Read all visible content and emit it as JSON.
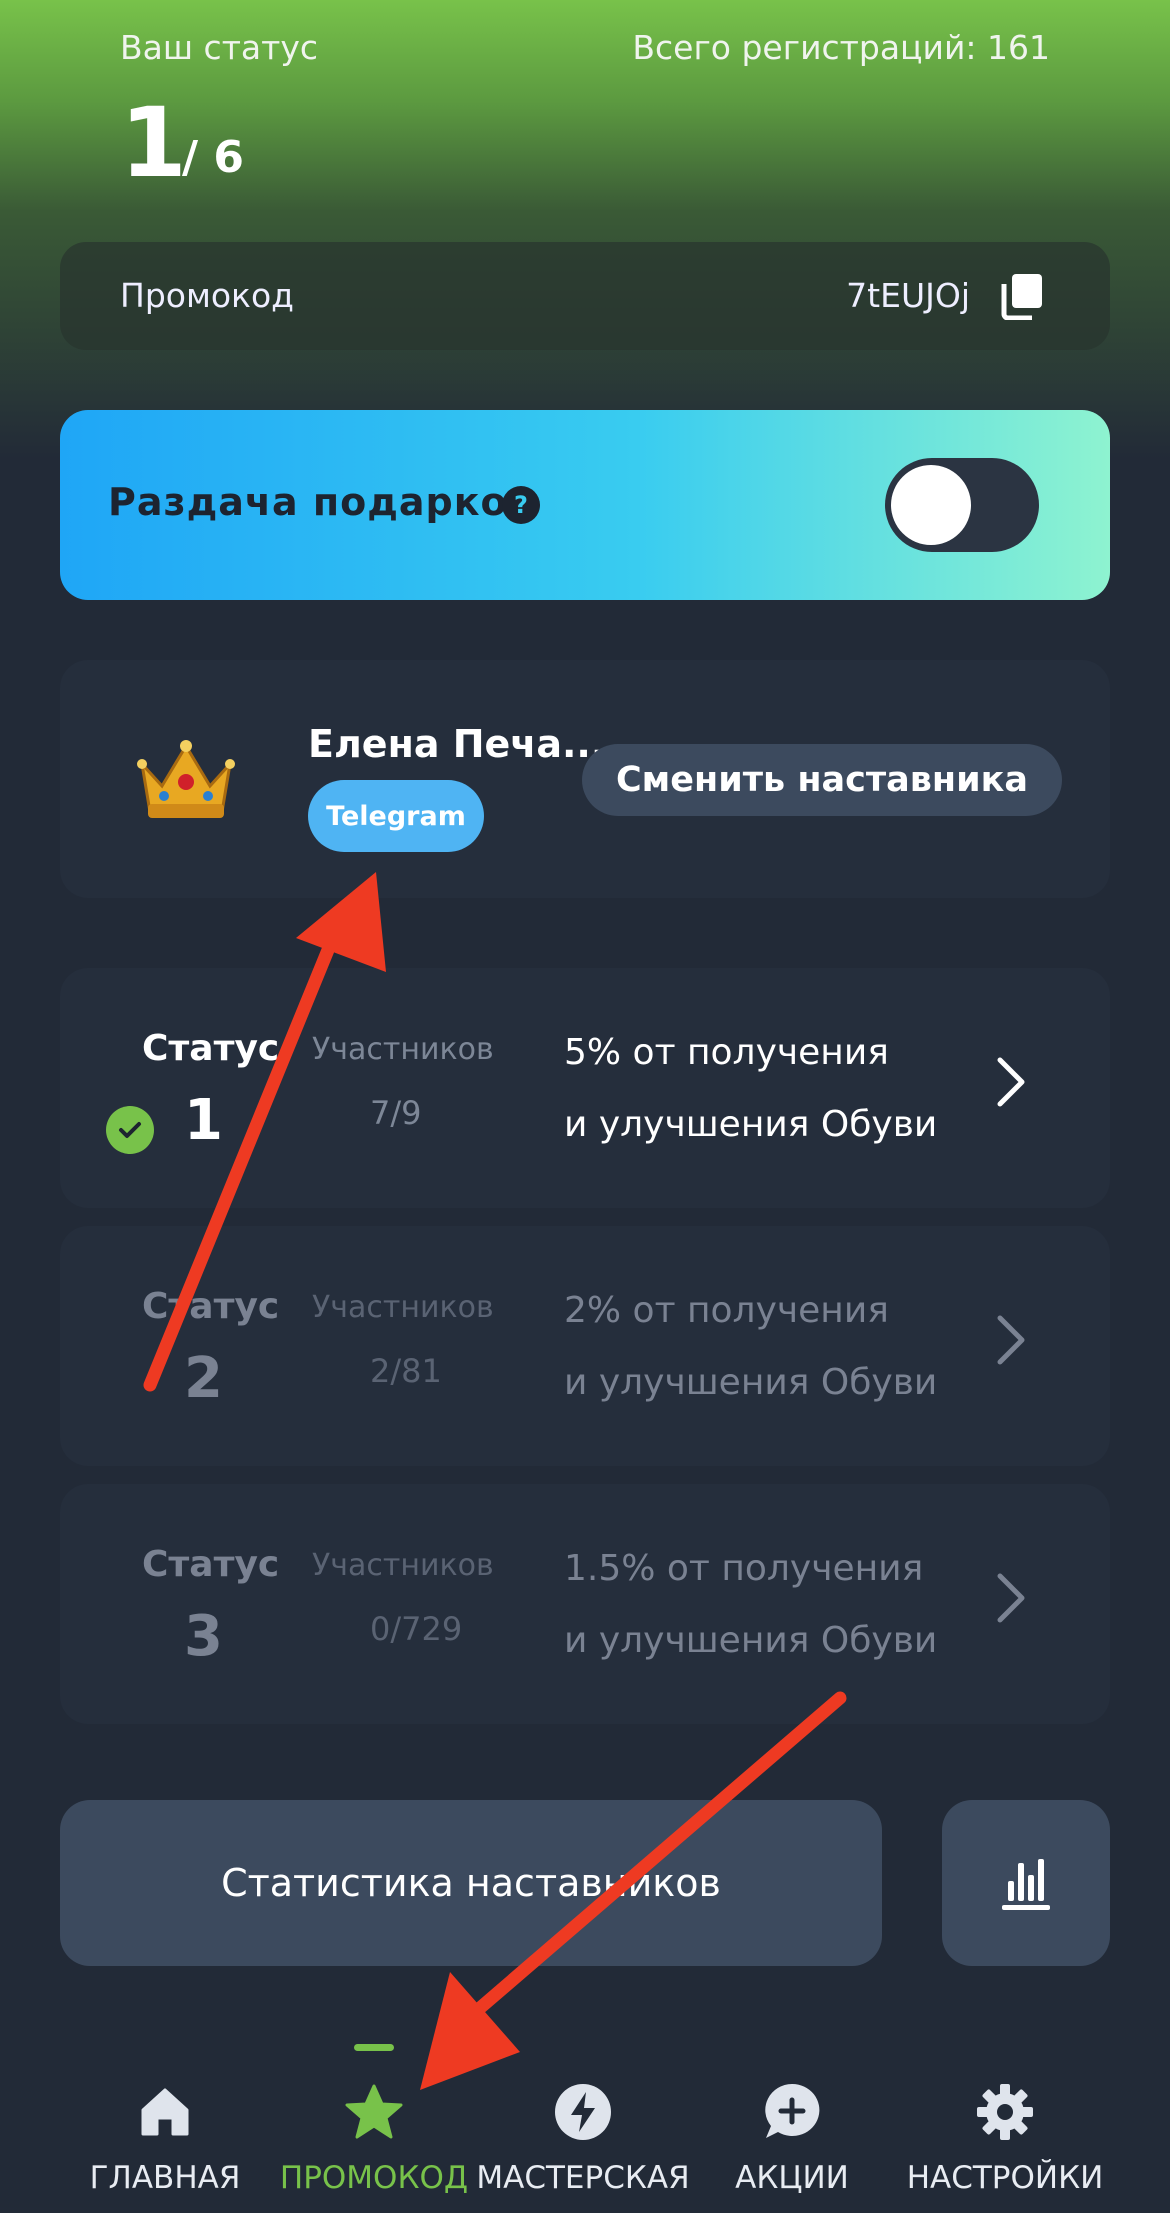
{
  "header": {
    "status_label": "Ваш статус",
    "total_label": "Всего регистраций: 161",
    "status_current": "1",
    "status_total": "/ 6"
  },
  "promo": {
    "label": "Промокод",
    "code": "7tEUJOj",
    "icon": "copy-icon"
  },
  "gifts": {
    "label": "Раздача подарков",
    "help": "?",
    "toggle_on": false
  },
  "mentor": {
    "name": "Елена Печа...",
    "badge": "Telegram",
    "change_label": "Сменить наставника",
    "avatar_icon": "crown-icon"
  },
  "levels": [
    {
      "status_label": "Статус",
      "number": "1",
      "participants_label": "Участников",
      "count": "7/9",
      "desc1": "5% от получения",
      "desc2": "и улучшения Обуви",
      "active": true
    },
    {
      "status_label": "Статус",
      "number": "2",
      "participants_label": "Участников",
      "count": "2/81",
      "desc1": "2% от получения",
      "desc2": "и улучшения Обуви",
      "active": false
    },
    {
      "status_label": "Статус",
      "number": "3",
      "participants_label": "Участников",
      "count": "0/729",
      "desc1": "1.5% от получения",
      "desc2": "и улучшения Обуви",
      "active": false
    }
  ],
  "stats": {
    "label": "Статистика наставников",
    "chart_icon": "bar-chart-icon"
  },
  "nav": {
    "items": [
      {
        "label": "ГЛАВНАЯ",
        "icon": "home-icon"
      },
      {
        "label": "ПРОМОКОД",
        "icon": "star-icon",
        "active": true
      },
      {
        "label": "МАСТЕРСКАЯ",
        "icon": "lightning-icon"
      },
      {
        "label": "АКЦИИ",
        "icon": "chat-plus-icon"
      },
      {
        "label": "НАСТРОЙКИ",
        "icon": "gear-icon"
      }
    ]
  },
  "colors": {
    "accent_green": "#78c24a",
    "background": "#222a37",
    "card": "#252e3c",
    "button": "#3c4a5e",
    "telegram": "#4fb4f3",
    "annotation_arrow": "#ee3a22"
  }
}
